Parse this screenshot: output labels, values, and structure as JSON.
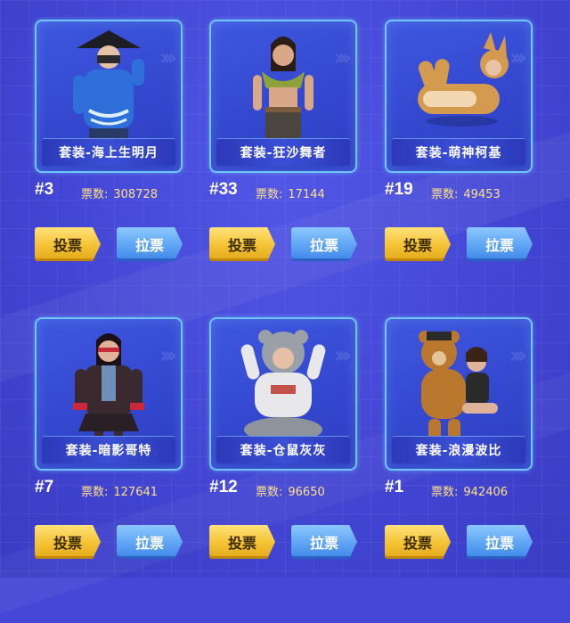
{
  "colors": {
    "vote_button": "#f4c233",
    "invite_button": "#5ea4f4",
    "card_border": "#6ec7ff",
    "vote_count": "#ffe08a"
  },
  "vote_label_prefix": "票数:",
  "cards": [
    {
      "name": "套装-海上生明月",
      "rank": "#3",
      "votes": "308728",
      "vote_btn": "投票",
      "invite_btn": "拉票",
      "theme": "#2f6fd9",
      "accent": "#dfeeff"
    },
    {
      "name": "套装-狂沙舞者",
      "rank": "#33",
      "votes": "17144",
      "vote_btn": "投票",
      "invite_btn": "拉票",
      "theme": "#8ea23a",
      "accent": "#c99b7a"
    },
    {
      "name": "套装-萌神柯基",
      "rank": "#19",
      "votes": "49453",
      "vote_btn": "投票",
      "invite_btn": "拉票",
      "theme": "#d49a4e",
      "accent": "#f2d7b3"
    },
    {
      "name": "套装-暗影哥特",
      "rank": "#7",
      "votes": "127641",
      "vote_btn": "投票",
      "invite_btn": "拉票",
      "theme": "#3a2a30",
      "accent": "#c8283a"
    },
    {
      "name": "套装-仓鼠灰灰",
      "rank": "#12",
      "votes": "96650",
      "vote_btn": "投票",
      "invite_btn": "拉票",
      "theme": "#e8e8ea",
      "accent": "#9aa0a8"
    },
    {
      "name": "套装-浪漫波比",
      "rank": "#1",
      "votes": "942406",
      "vote_btn": "投票",
      "invite_btn": "拉票",
      "theme": "#b9782d",
      "accent": "#2a2a2a"
    }
  ]
}
